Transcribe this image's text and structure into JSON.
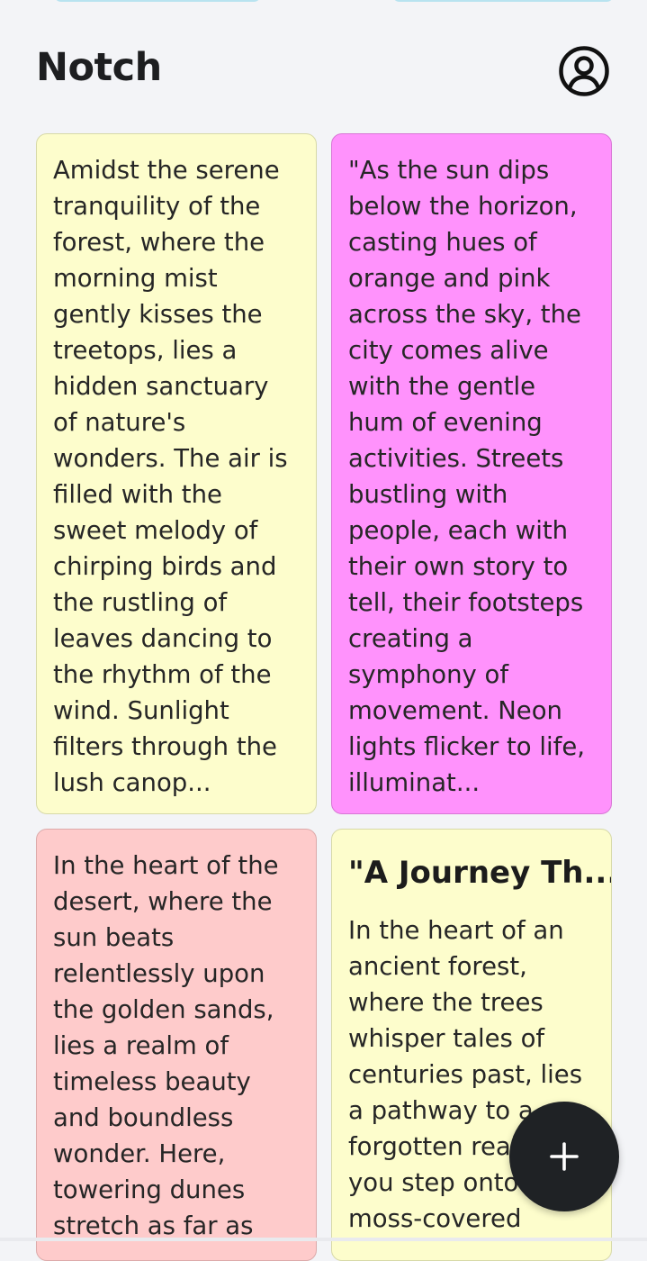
{
  "app": {
    "title": "Notch"
  },
  "icons": {
    "profile": "user-circle-icon",
    "add": "plus-icon"
  },
  "colors": {
    "background": "#f3f4f7",
    "fab": "#1f2225"
  },
  "notes": [
    {
      "title": "",
      "body": "Amidst the serene tranquility of the forest, where the morning mist gently kisses the treetops, lies a hidden sanctuary of nature's wonders. The air is filled with the sweet melody of chirping birds and the rustling of leaves dancing to the rhythm of the wind. Sunlight filters through the lush canop...",
      "color": "#fdfdcc",
      "border": "#d7d9a8"
    },
    {
      "title": "",
      "body": "\"As the sun dips below the horizon, casting hues of orange and pink across the sky, the city comes alive with the gentle hum of evening activities. Streets bustling with people, each with their own story to tell, their footsteps creating a symphony of movement. Neon lights flicker to life, illuminat...",
      "color": "#ff92fc",
      "border": "#d876d5"
    },
    {
      "title": "",
      "body": "In the heart of the desert, where the sun beats relentlessly upon the golden sands, lies a realm of timeless beauty and boundless wonder. Here, towering dunes stretch as far as",
      "color": "#fecbcb",
      "border": "#dcaaaa"
    },
    {
      "title": "\"A Journey Th...",
      "body": "In the heart of an ancient forest, where the trees whisper tales of centuries past, lies a pathway to a forgotten realm. As you step onto moss-covered",
      "color": "#fdfdcc",
      "border": "#d7d9a8"
    }
  ]
}
